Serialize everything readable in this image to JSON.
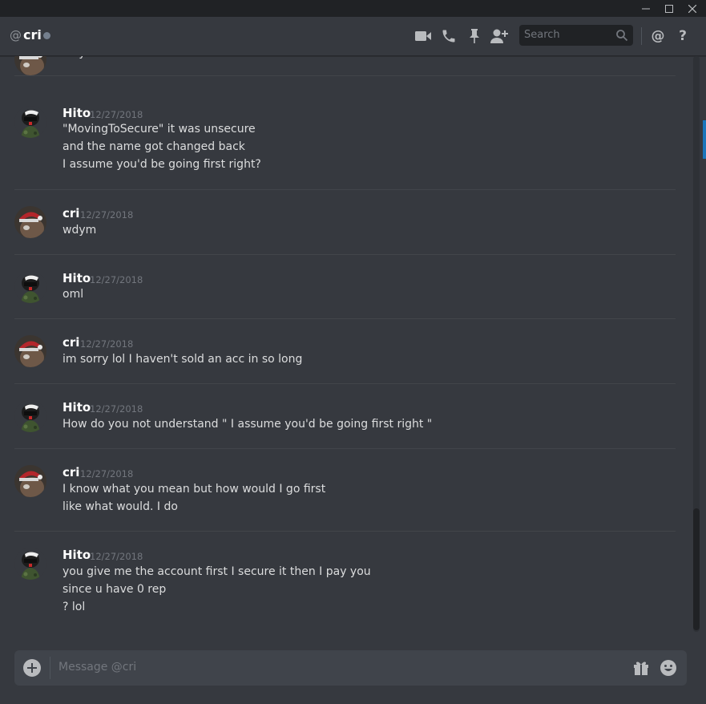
{
  "window": {
    "minimize_icon": "minimize-icon",
    "maximize_icon": "maximize-icon",
    "close_icon": "close-icon"
  },
  "header": {
    "at_symbol": "@",
    "channel_name": "cri",
    "status": "offline",
    "icons": [
      "video-call-icon",
      "voice-call-icon",
      "pin-icon",
      "add-friend-icon",
      "mention-icon",
      "help-icon"
    ],
    "search_placeholder": "Search",
    "mention_symbol": "@",
    "help_symbol": "?"
  },
  "messages": [
    {
      "lines": [
        "wdym"
      ],
      "partial": true,
      "author": "cri"
    },
    {
      "author": "Hito",
      "timestamp": "12/27/2018",
      "lines": [
        "\"MovingToSecure\" it was unsecure",
        "and the name got changed back",
        "I assume you'd be going first right?"
      ]
    },
    {
      "author": "cri",
      "timestamp": "12/27/2018",
      "lines": [
        "wdym"
      ]
    },
    {
      "author": "Hito",
      "timestamp": "12/27/2018",
      "lines": [
        "oml"
      ]
    },
    {
      "author": "cri",
      "timestamp": "12/27/2018",
      "lines": [
        "im sorry lol I haven't sold an acc in so long"
      ]
    },
    {
      "author": "Hito",
      "timestamp": "12/27/2018",
      "lines": [
        "How do you not understand \" I assume you'd be going first right \""
      ]
    },
    {
      "author": "cri",
      "timestamp": "12/27/2018",
      "lines": [
        "I know what you mean but how would I go first",
        "like what would. I do"
      ]
    },
    {
      "author": "Hito",
      "timestamp": "12/27/2018",
      "lines": [
        "you give me the account first I secure it then  I pay you",
        "since u have 0 rep",
        "? lol"
      ]
    }
  ],
  "composer": {
    "placeholder": "Message @cri",
    "icons": [
      "add-attachment-icon",
      "gift-icon",
      "emoji-icon"
    ]
  },
  "colors": {
    "background": "#36393f",
    "titlebar": "#202225",
    "text": "#dcddde",
    "timestamp": "#72767d",
    "status_offline": "#747f8d"
  }
}
